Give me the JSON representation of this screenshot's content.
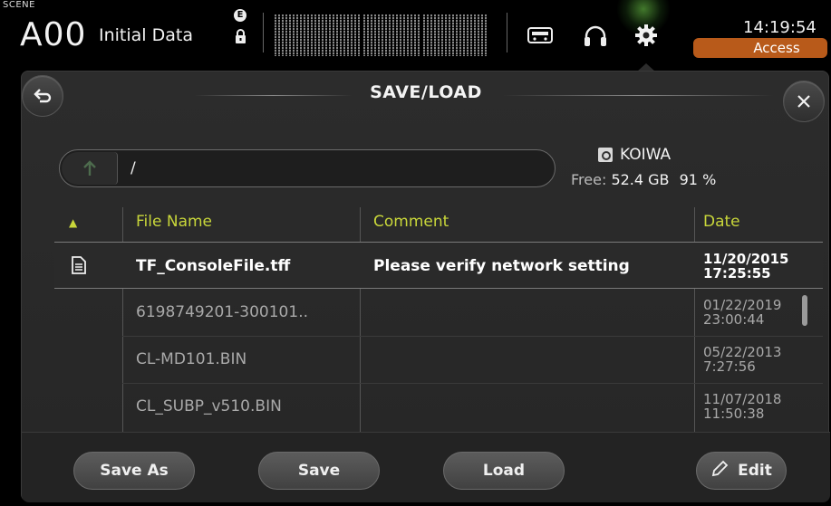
{
  "header": {
    "scene_label": "SCENE",
    "scene_number": "A00",
    "scene_name": "Initial Data",
    "e_badge": "E",
    "time": "14:19:54",
    "access_label": "Access"
  },
  "dialog": {
    "title": "SAVE/LOAD",
    "path": "/",
    "device_name": "KOIWA",
    "free_label": "Free:",
    "free_space": "52.4 GB",
    "free_percent": "91 %"
  },
  "table": {
    "sort_indicator": "▲",
    "columns": [
      "File Name",
      "Comment",
      "Date"
    ],
    "rows": [
      {
        "name": "TF_ConsoleFile.tff",
        "comment": "Please verify network setting",
        "date": "11/20/2015",
        "time": "17:25:55",
        "selected": true
      },
      {
        "name": "6198749201-300101..",
        "comment": "",
        "date": "01/22/2019",
        "time": "23:00:44",
        "selected": false
      },
      {
        "name": "CL-MD101.BIN",
        "comment": "",
        "date": "05/22/2013",
        "time": "7:27:56",
        "selected": false
      },
      {
        "name": "CL_SUBP_v510.BIN",
        "comment": "",
        "date": "11/07/2018",
        "time": "11:50:38",
        "selected": false
      }
    ]
  },
  "buttons": {
    "save_as": "Save As",
    "save": "Save",
    "load": "Load",
    "edit": "Edit"
  },
  "colors": {
    "accent_header": "#c8d63a",
    "access_bg": "#b85a1a"
  },
  "icons": [
    "back-icon",
    "close-icon",
    "folder-up-icon",
    "storage-device-icon",
    "file-icon",
    "pencil-icon",
    "recorder-icon",
    "headphones-icon",
    "gear-icon",
    "lock-icon"
  ]
}
